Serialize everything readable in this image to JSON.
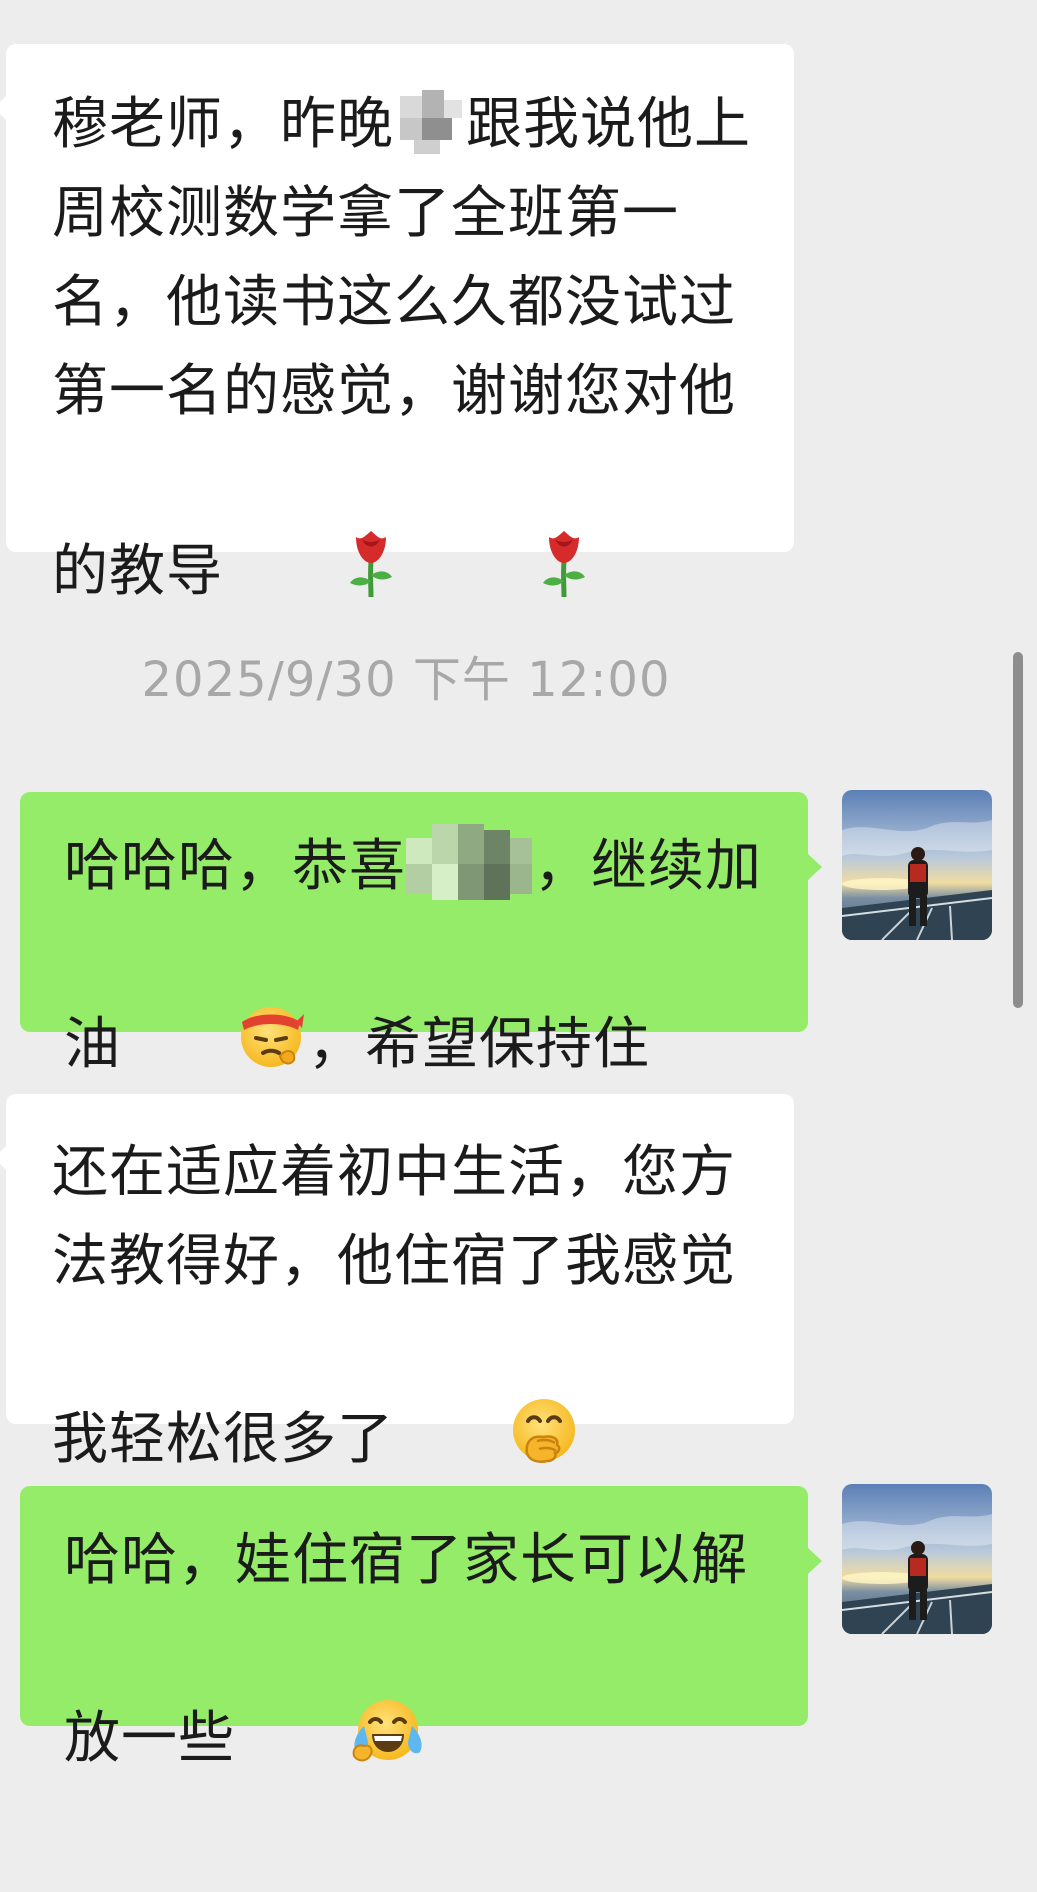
{
  "chat": {
    "msg1": {
      "part1": "穆老师，昨晚",
      "part2": "跟我说他上周校测数学拿了全班第一名，他读书这么久都没试过第一名的感觉，谢谢您对他的教导"
    },
    "timestamp": "2025/9/30 下午 12:00",
    "msg2": {
      "part1": "哈哈哈，恭喜",
      "part2": "，继续加油",
      "part3": "，希望保持住"
    },
    "msg3": {
      "part1": "还在适应着初中生活，您方法教得好，他住宿了我感觉我轻松很多了"
    },
    "msg4": {
      "part1": "哈哈，娃住宿了家长可以解放一些"
    }
  },
  "icons": {
    "rose": "rose-icon",
    "determined_face": "determined-face-icon",
    "grin": "grinning-face-icon",
    "hand_over_mouth": "hand-over-mouth-face-icon",
    "tears_of_joy": "tears-of-joy-face-icon"
  },
  "colors": {
    "background": "#ededed",
    "incoming_bubble": "#ffffff",
    "outgoing_bubble": "#95ec69",
    "timestamp": "#a8a8a8"
  }
}
